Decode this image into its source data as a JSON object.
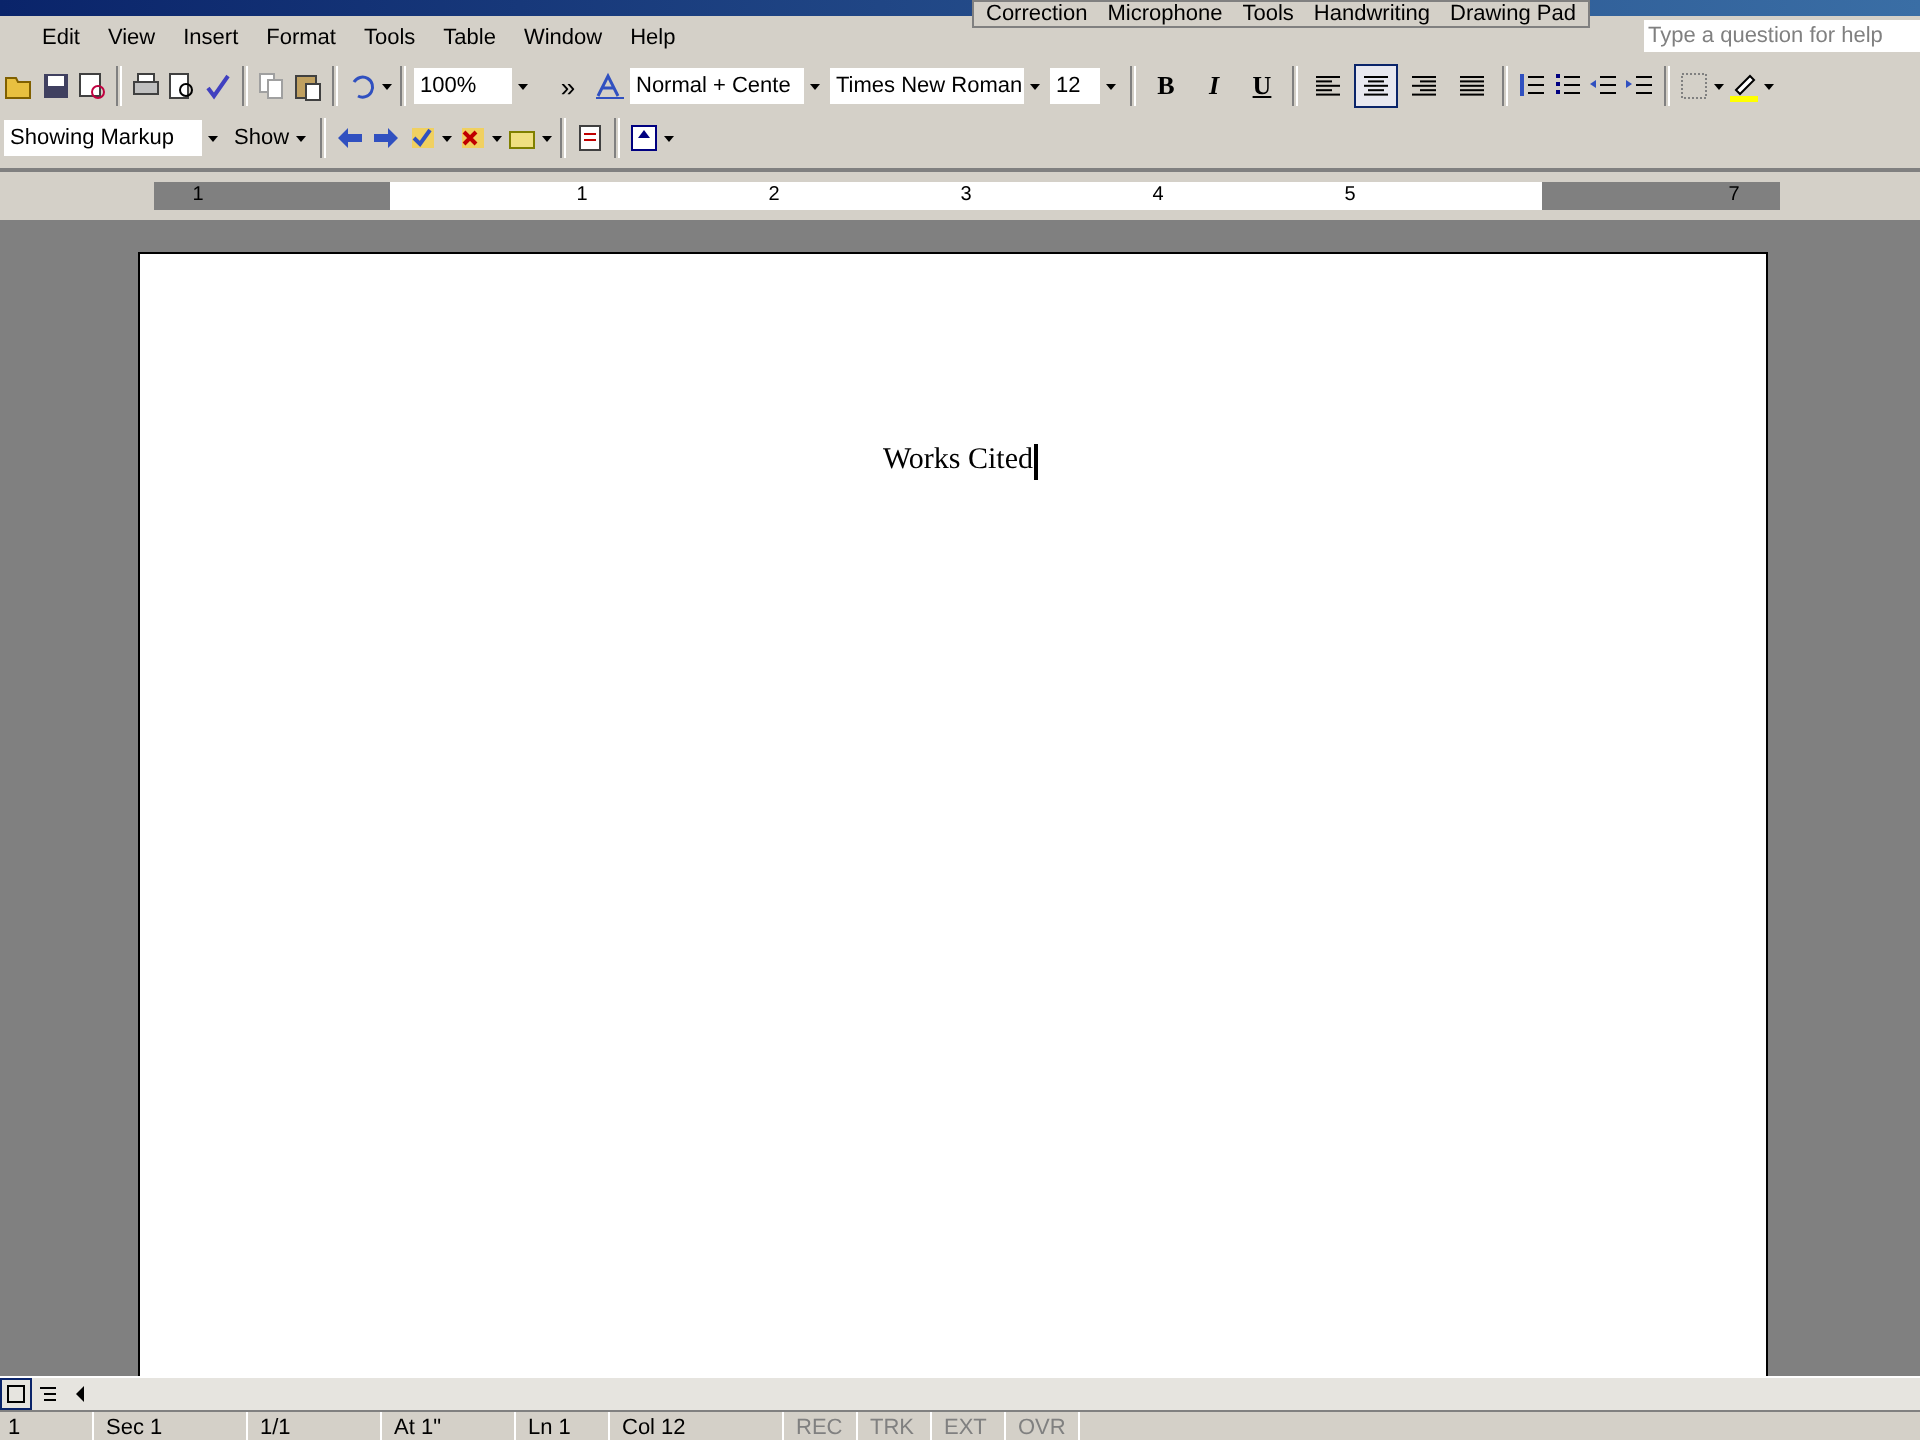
{
  "language_bar": [
    "Correction",
    "Microphone",
    "Tools",
    "Handwriting",
    "Drawing Pad"
  ],
  "menu": [
    "Edit",
    "View",
    "Insert",
    "Format",
    "Tools",
    "Table",
    "Window",
    "Help"
  ],
  "help_box": {
    "placeholder": "Type a question for help"
  },
  "formatting": {
    "zoom": "100%",
    "overflow": "»",
    "style": "Normal + Cente",
    "font": "Times New Roman",
    "size": "12",
    "bold": "B",
    "italic": "I",
    "underline": "U"
  },
  "alignment": [
    {
      "kind": "left",
      "selected": false
    },
    {
      "kind": "center",
      "selected": true
    },
    {
      "kind": "right",
      "selected": false
    },
    {
      "kind": "justify",
      "selected": false
    }
  ],
  "reviewing": {
    "display": "Showing Markup",
    "show": "Show"
  },
  "ruler": [
    "1",
    "1",
    "2",
    "3",
    "4",
    "5",
    "7"
  ],
  "document": {
    "text": "Works Cited"
  },
  "status_bar": [
    "1",
    "Sec 1",
    "1/1",
    "At 1\"",
    "Ln 1",
    "Col 12"
  ],
  "modes": [
    {
      "label": "REC",
      "on": false
    },
    {
      "label": "TRK",
      "on": false
    },
    {
      "label": "EXT",
      "on": false
    },
    {
      "label": "OVR",
      "on": false
    }
  ]
}
